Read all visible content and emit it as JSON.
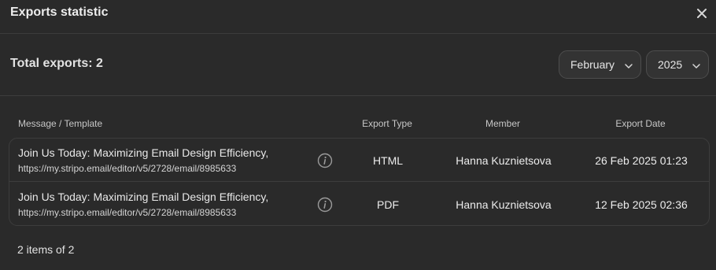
{
  "dialog": {
    "title": "Exports statistic"
  },
  "summary": {
    "total_label": "Total exports: 2",
    "month": "February",
    "year": "2025"
  },
  "table": {
    "headers": {
      "message": "Message / Template",
      "export_type": "Export Type",
      "member": "Member",
      "export_date": "Export Date"
    },
    "rows": [
      {
        "title": "Join Us Today: Maximizing Email Design Efficiency,",
        "url": "https://my.stripo.email/editor/v5/2728/email/8985633",
        "export_type": "HTML",
        "member": "Hanna Kuznietsova",
        "export_date": "26 Feb 2025 01:23"
      },
      {
        "title": "Join Us Today: Maximizing Email Design Efficiency,",
        "url": "https://my.stripo.email/editor/v5/2728/email/8985633",
        "export_type": "PDF",
        "member": "Hanna Kuznietsova",
        "export_date": "12 Feb 2025 02:36"
      }
    ]
  },
  "footer": {
    "pagination": "2 items of 2"
  },
  "icons": {
    "close": "close-icon",
    "dropdown": "chevron-down-icon",
    "info": "info-icon"
  },
  "colors": {
    "background": "#2a2a2a",
    "divider": "#3c3c3c",
    "text": "#e6e6e6"
  }
}
